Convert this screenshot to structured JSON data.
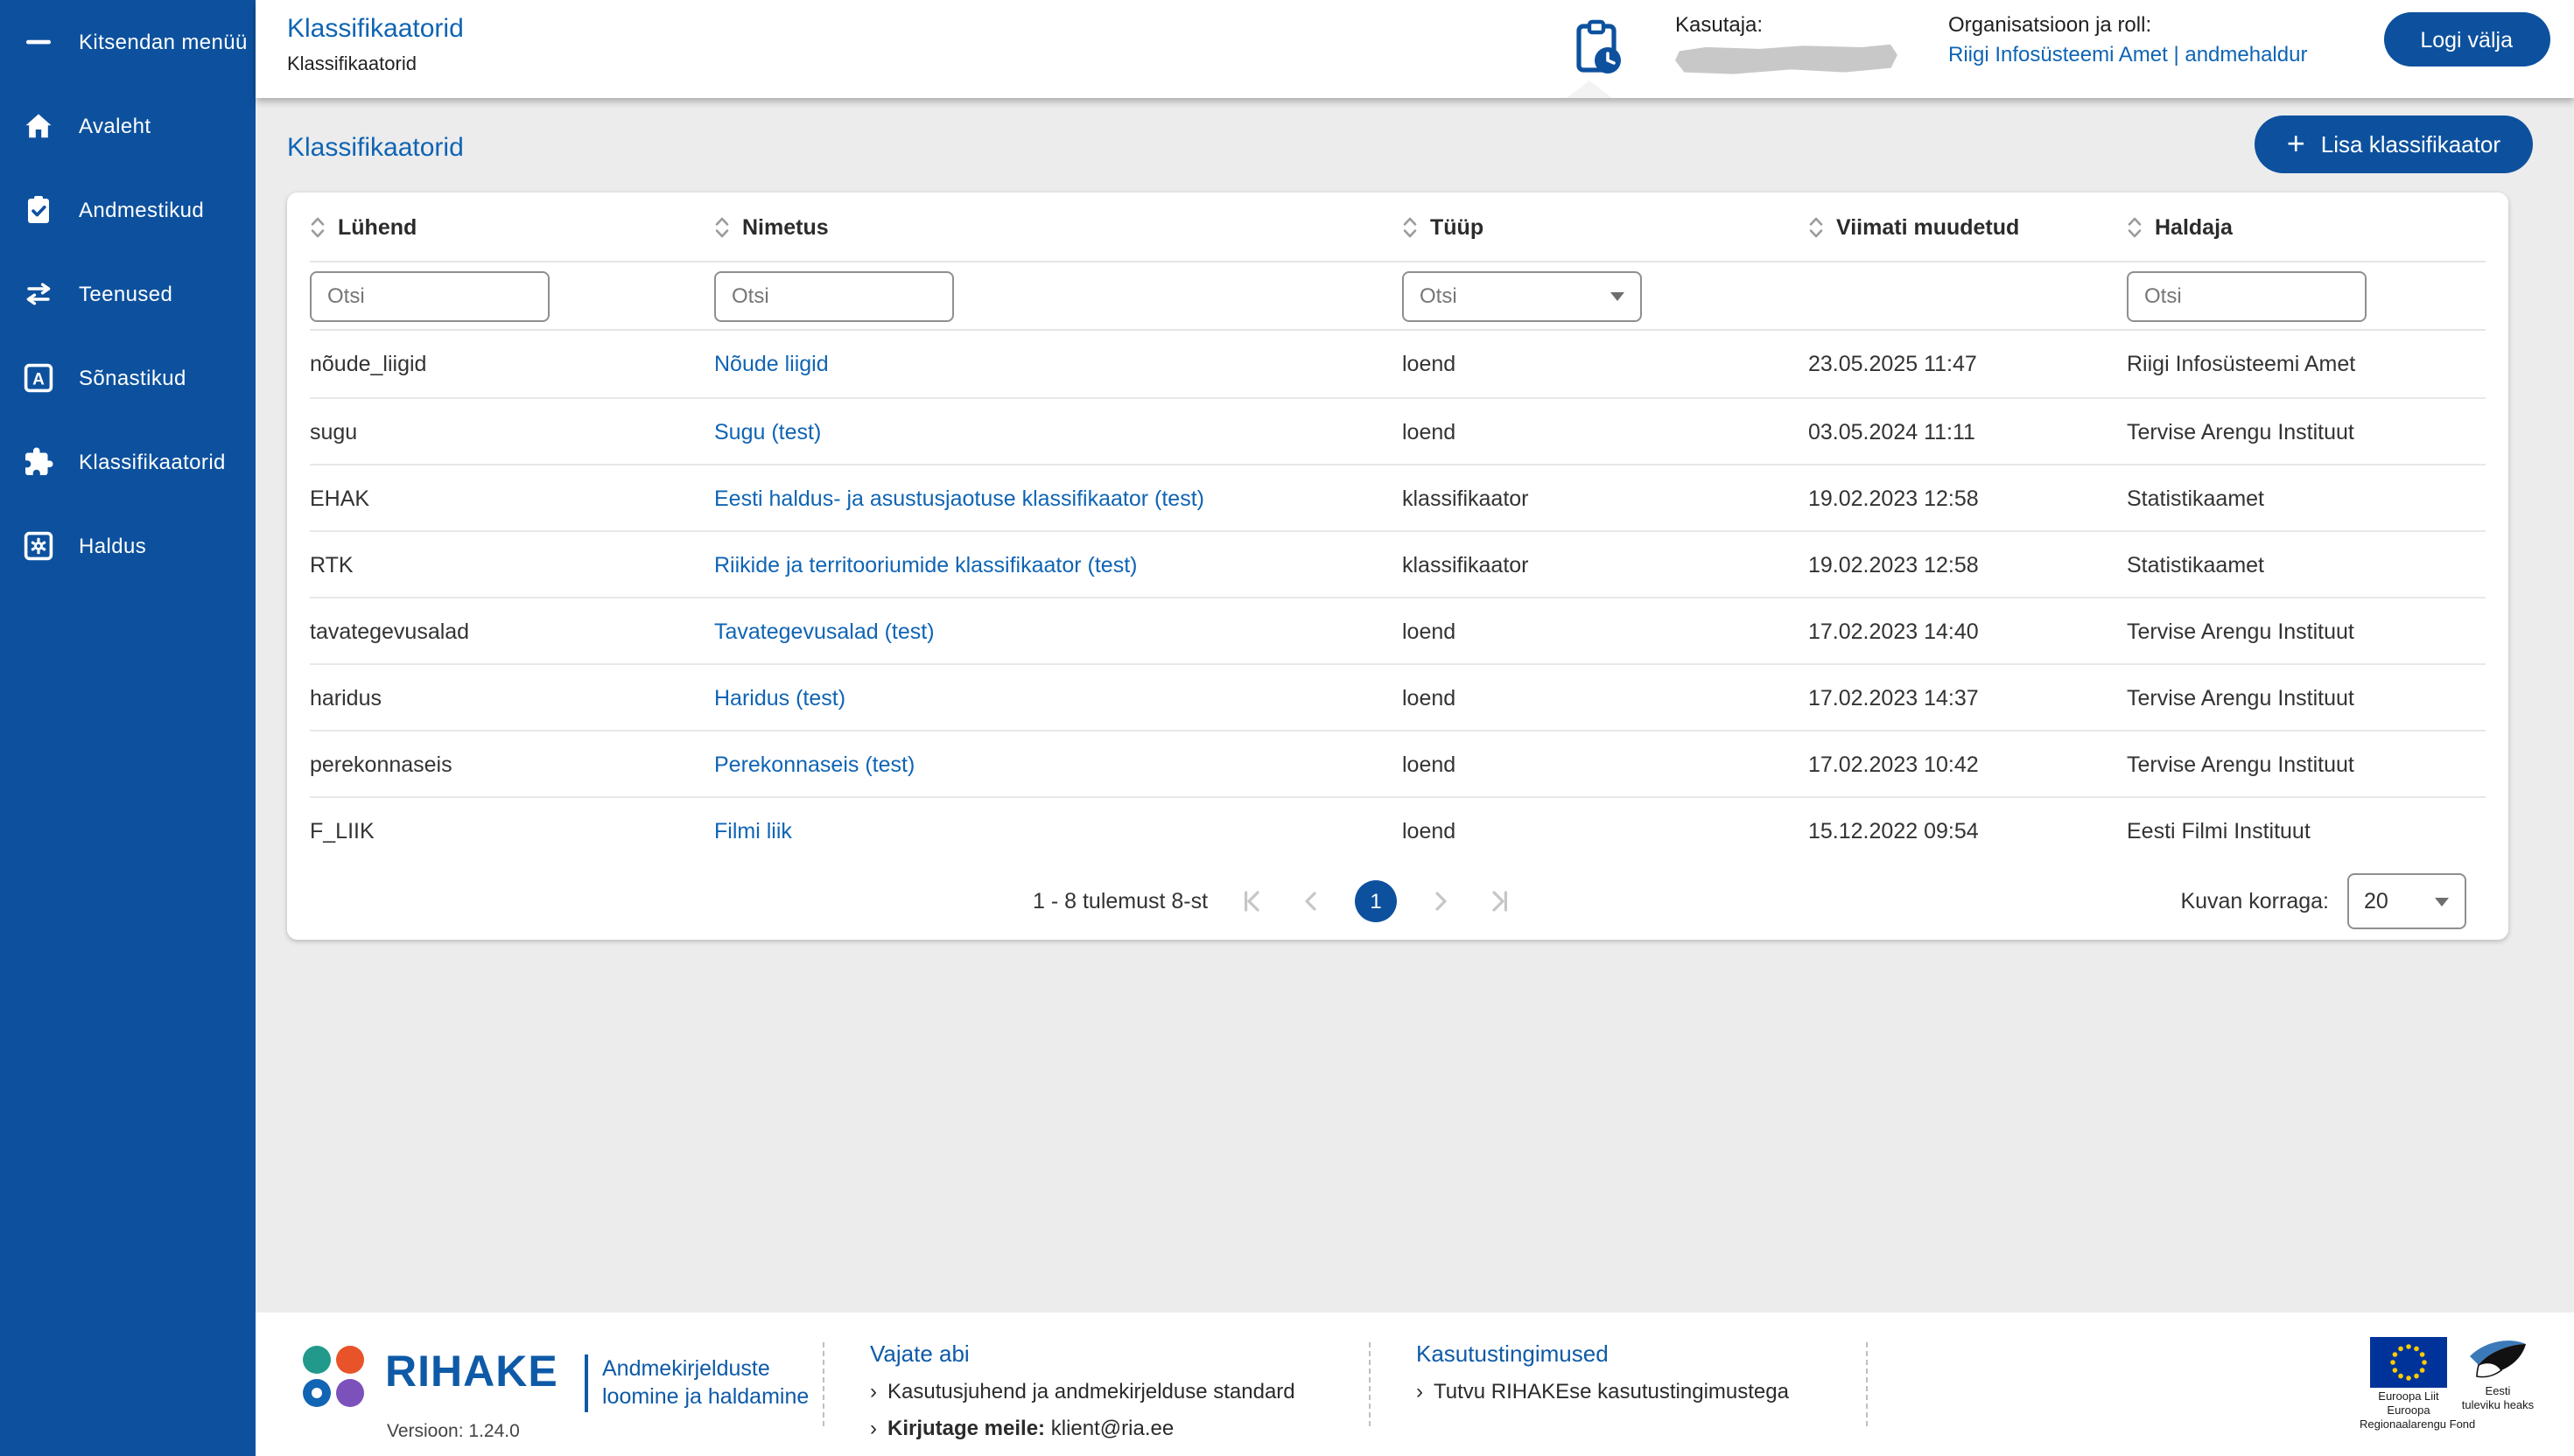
{
  "sidebar": {
    "items": [
      {
        "label": "Kitsendan menüü",
        "icon": "collapse-menu-icon"
      },
      {
        "label": "Avaleht",
        "icon": "home-icon"
      },
      {
        "label": "Andmestikud",
        "icon": "clipboard-check-icon"
      },
      {
        "label": "Teenused",
        "icon": "transfer-arrows-icon"
      },
      {
        "label": "Sõnastikud",
        "icon": "dictionary-a-icon"
      },
      {
        "label": "Klassifikaatorid",
        "icon": "puzzle-icon"
      },
      {
        "label": "Haldus",
        "icon": "settings-icon"
      }
    ]
  },
  "header": {
    "title": "Klassifikaatorid",
    "breadcrumb": "Klassifikaatorid",
    "user_label": "Kasutaja:",
    "org_label": "Organisatsioon ja roll:",
    "org_value": "Riigi Infosüsteemi Amet | andmehaldur",
    "logout_label": "Logi välja"
  },
  "main": {
    "page_title": "Klassifikaatorid",
    "add_button_label": "Lisa klassifikaator",
    "table": {
      "columns": [
        "Lühend",
        "Nimetus",
        "Tüüp",
        "Viimati muudetud",
        "Haldaja"
      ],
      "filters": {
        "code_placeholder": "Otsi",
        "name_placeholder": "Otsi",
        "type_placeholder": "Otsi",
        "manager_placeholder": "Otsi"
      },
      "rows": [
        {
          "code": "nõude_liigid",
          "name": "Nõude liigid",
          "type": "loend",
          "modified": "23.05.2025 11:47",
          "manager": "Riigi Infosüsteemi Amet"
        },
        {
          "code": "sugu",
          "name": "Sugu (test)",
          "type": "loend",
          "modified": "03.05.2024 11:11",
          "manager": "Tervise Arengu Instituut"
        },
        {
          "code": "EHAK",
          "name": "Eesti haldus- ja asustusjaotuse klassifikaator (test)",
          "type": "klassifikaator",
          "modified": "19.02.2023 12:58",
          "manager": "Statistikaamet"
        },
        {
          "code": "RTK",
          "name": "Riikide ja territooriumide klassifikaator (test)",
          "type": "klassifikaator",
          "modified": "19.02.2023 12:58",
          "manager": "Statistikaamet"
        },
        {
          "code": "tavategevusalad",
          "name": "Tavategevusalad (test)",
          "type": "loend",
          "modified": "17.02.2023 14:40",
          "manager": "Tervise Arengu Instituut"
        },
        {
          "code": "haridus",
          "name": "Haridus (test)",
          "type": "loend",
          "modified": "17.02.2023 14:37",
          "manager": "Tervise Arengu Instituut"
        },
        {
          "code": "perekonnaseis",
          "name": "Perekonnaseis (test)",
          "type": "loend",
          "modified": "17.02.2023 10:42",
          "manager": "Tervise Arengu Instituut"
        },
        {
          "code": "F_LIIK",
          "name": "Filmi liik",
          "type": "loend",
          "modified": "15.12.2022 09:54",
          "manager": "Eesti Filmi Instituut"
        }
      ]
    },
    "pagination": {
      "summary": "1 - 8 tulemust 8-st",
      "current_page": "1",
      "page_size_label": "Kuvan korraga:",
      "page_size": "20"
    }
  },
  "footer": {
    "brand": "RIHAKE",
    "tagline_line1": "Andmekirjelduste",
    "tagline_line2": "loomine ja haldamine",
    "version": "Versioon: 1.24.0",
    "help": {
      "title": "Vajate abi",
      "link1": "Kasutusjuhend ja andmekirjelduse standard",
      "link2_label": "Kirjutage meile:",
      "link2_value": "klient@ria.ee"
    },
    "terms": {
      "title": "Kasutustingimused",
      "link1": "Tutvu RIHAKEse kasutustingimustega"
    },
    "eu_logo": {
      "line1": "Euroopa Liit",
      "line2": "Euroopa",
      "line3": "Regionaalarengu Fond"
    },
    "estonia_logo": {
      "line1": "Eesti",
      "line2": "tuleviku heaks"
    }
  },
  "colors": {
    "primary_blue": "#0D519E",
    "link_blue": "#0F64B4",
    "footer_blue": "#0E5AA7"
  }
}
